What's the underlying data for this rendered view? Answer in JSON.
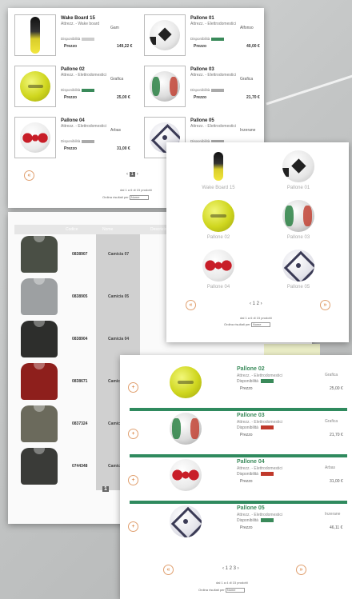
{
  "colors": {
    "accent_green": "#2f8a5e",
    "accent_orange": "#d26a1a",
    "avail_green": "#3a8a5a",
    "avail_red": "#c0392b"
  },
  "panel_a": {
    "items": [
      {
        "name": "Wake Board 15",
        "category": "Attrezz. - Wake board",
        "brand": "Gam",
        "availability": "Disponibilità",
        "avail_color": "#cccccc",
        "price_label": "Prezzo",
        "price": "149,22 €",
        "image": "wakeboard"
      },
      {
        "name": "Pallone 01",
        "category": "Attrezz. - Elettrodomestici",
        "brand": "Alfonso",
        "availability": "Disponibilità",
        "avail_color": "#3a8a5a",
        "price_label": "Prezzo",
        "price": "40,00 €",
        "image": "ball-soccer"
      },
      {
        "name": "Pallone 02",
        "category": "Attrezz. - Elettrodomestici",
        "brand": "Grafica",
        "availability": "Disponibilità",
        "avail_color": "#3a8a5a",
        "price_label": "Prezzo",
        "price": "25,00 €",
        "image": "ball-yellow"
      },
      {
        "name": "Pallone 03",
        "category": "Attrezz. - Elettrodomestici",
        "brand": "Grafica",
        "availability": "Disponibilità",
        "avail_color": "#aaaaaa",
        "price_label": "Prezzo",
        "price": "21,70 €",
        "image": "ball-green"
      },
      {
        "name": "Pallone 04",
        "category": "Attrezz. - Elettrodomestici",
        "brand": "Arbas",
        "availability": "Disponibilità",
        "avail_color": "#aaaaaa",
        "price_label": "Prezzo",
        "price": "31,00 €",
        "image": "ball-red"
      },
      {
        "name": "Pallone 05",
        "category": "Attrezz. - Elettrodomestici",
        "brand": "Inzerane",
        "availability": "Disponibilità",
        "avail_color": "#aaaaaa",
        "price_label": "Prezzo",
        "price": "",
        "image": "ball-star"
      }
    ],
    "pager": {
      "prev": "‹",
      "current": "1",
      "next": "›"
    },
    "count_text": "dal 1 a 6 di 15 prodotti",
    "sort_label": "Ordina risultati per",
    "sort_value": "Nome"
  },
  "panel_b": {
    "header": {
      "code": "Codice",
      "name": "Nome",
      "extra": "Descrizione"
    },
    "rows": [
      {
        "code": "0838907",
        "name": "Camicia 07",
        "extra": "Ab",
        "color": "#4a4f45"
      },
      {
        "code": "0838905",
        "name": "Camicia 05",
        "extra": "Ab",
        "color": "#9da0a2"
      },
      {
        "code": "0838904",
        "name": "Camicia 04",
        "extra": "Ab",
        "color": "#2d2e2c"
      },
      {
        "code": "0838671",
        "name": "Camicia 03",
        "extra": "",
        "color": "#8e1f1c"
      },
      {
        "code": "0837324",
        "name": "Camicia 02",
        "extra": "",
        "color": "#6b6a5c"
      },
      {
        "code": "0744348",
        "name": "Camicia 01",
        "extra": "",
        "color": "#3a3b38"
      }
    ],
    "pager": "‹ 1 2 ›",
    "pager_current": "1"
  },
  "panel_c": {
    "items": [
      {
        "label": "Wake Board 15",
        "image": "wakeboard"
      },
      {
        "label": "Pallone 01",
        "image": "ball-soccer"
      },
      {
        "label": "Pallone 02",
        "image": "ball-yellow"
      },
      {
        "label": "Pallone 03",
        "image": "ball-green"
      },
      {
        "label": "Pallone 04",
        "image": "ball-red"
      },
      {
        "label": "Pallone 05",
        "image": "ball-star"
      }
    ],
    "pager": "‹ 1 2 ›",
    "count_text": "dal 1 a 6 di 15 prodotti",
    "sort_label": "Ordina risultati per",
    "sort_value": "Nome"
  },
  "panel_d": {
    "items": [
      {
        "name": "Pallone 02",
        "category": "Attrezz. - Elettrodomestici",
        "availability": "Disponibilità",
        "avail_color": "#3a8a5a",
        "price_label": "Prezzo",
        "brand": "Grafica",
        "price": "25,00 €",
        "image": "ball-yellow"
      },
      {
        "name": "Pallone 03",
        "category": "Attrezz. - Elettrodomestici",
        "availability": "Disponibilità",
        "avail_color": "#c0392b",
        "price_label": "Prezzo",
        "brand": "Grafica",
        "price": "21,70 €",
        "image": "ball-green"
      },
      {
        "name": "Pallone 04",
        "category": "Attrezz. - Elettrodomestici",
        "availability": "Disponibilità",
        "avail_color": "#c0392b",
        "price_label": "Prezzo",
        "brand": "Arbas",
        "price": "31,00 €",
        "image": "ball-red"
      },
      {
        "name": "Pallone 05",
        "category": "Attrezz. - Elettrodomestici",
        "availability": "Disponibilità",
        "avail_color": "#3a8a5a",
        "price_label": "Prezzo",
        "brand": "Inzerane",
        "price": "46,11 €",
        "image": "ball-star"
      }
    ],
    "pager": "‹ 1 2 3 ›",
    "count_text": "dal 1 a 4 di 15 prodotti",
    "sort_label": "Ordina risultati per",
    "sort_value": "Nome"
  }
}
